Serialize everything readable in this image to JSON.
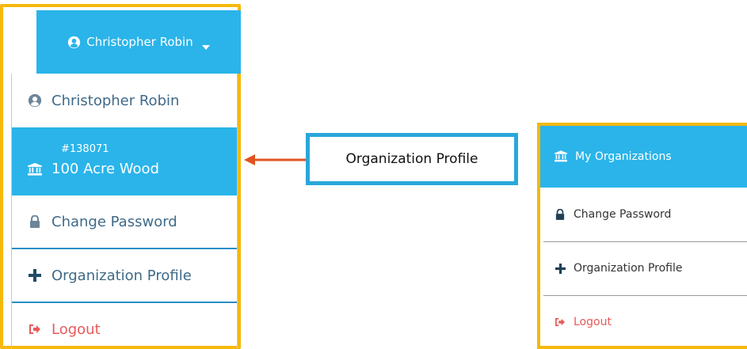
{
  "left_panel": {
    "header_user": "Christopher Robin",
    "menu": {
      "user_name": "Christopher Robin",
      "org_id": "#138071",
      "org_name": "100 Acre Wood",
      "change_password": "Change Password",
      "organization_profile": "Organization Profile",
      "logout": "Logout"
    }
  },
  "callout": {
    "label": "Organization Profile"
  },
  "right_panel": {
    "header": "My Organizations",
    "change_password": "Change Password",
    "organization_profile": "Organization Profile",
    "logout": "Logout"
  },
  "colors": {
    "accent_blue": "#2ab4ea",
    "frame_yellow": "#f5b80c",
    "callout_border": "#2aa7da",
    "arrow": "#e0531f",
    "logout_red": "#e85a5a",
    "menu_text": "#3f6a88"
  },
  "icons": [
    "user-circle-icon",
    "caret-down-icon",
    "bank-icon",
    "lock-icon",
    "plus-icon",
    "sign-out-icon"
  ]
}
